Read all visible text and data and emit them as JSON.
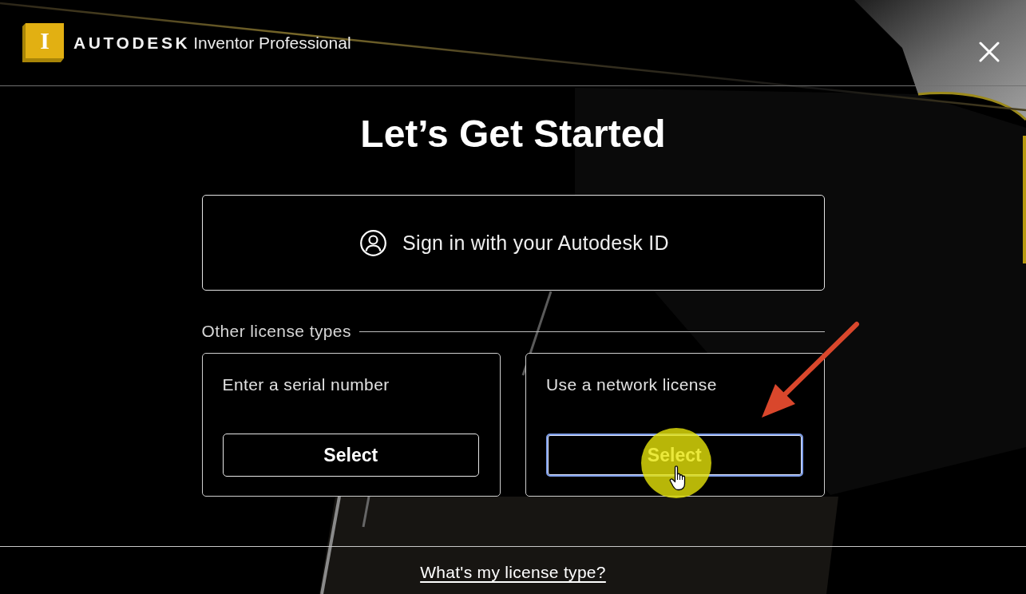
{
  "header": {
    "logo_letter": "I",
    "brand": "AUTODESK",
    "product": "Inventor Professional"
  },
  "title": "Let’s Get Started",
  "sign_in": {
    "label": "Sign in with your Autodesk ID"
  },
  "other_license_types": {
    "label": "Other license types"
  },
  "options": [
    {
      "label": "Enter a serial number",
      "pointed_at": false,
      "button": {
        "label": "Select",
        "focused": false,
        "highlighted": false
      }
    },
    {
      "label": "Use a network license",
      "pointed_at": true,
      "button": {
        "label": "Select",
        "focused": true,
        "highlighted": true
      }
    }
  ],
  "footer": {
    "link": "What's my license type?"
  }
}
